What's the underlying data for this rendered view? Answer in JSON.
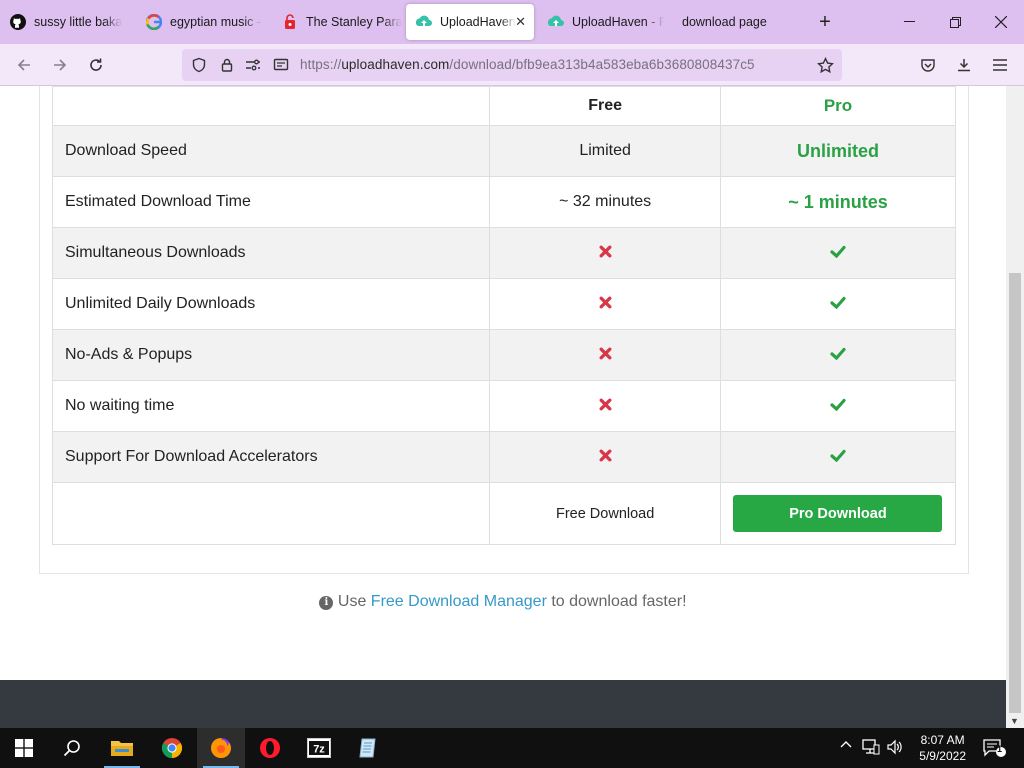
{
  "tabs": [
    {
      "label": "sussy little baka",
      "icon": "github-icon"
    },
    {
      "label": "egyptian music -",
      "icon": "google-icon"
    },
    {
      "label": "The Stanley Parab",
      "icon": "game-icon"
    },
    {
      "label": "UploadHaven",
      "icon": "uploadhaven-icon",
      "active": true
    },
    {
      "label": "UploadHaven - Fi",
      "icon": "uploadhaven-icon"
    },
    {
      "label": "download page",
      "icon": ""
    }
  ],
  "url": {
    "scheme": "https://",
    "host": "uploadhaven.com",
    "path": "/download/bfb9ea313b4a583eba6b3680808437c5"
  },
  "table": {
    "header_free": "Free",
    "header_pro": "Pro",
    "rows": [
      {
        "feature": "Download Speed",
        "free": "Limited",
        "pro": "Unlimited"
      },
      {
        "feature": "Estimated Download Time",
        "free": "~ 32 minutes",
        "pro": "~ 1 minutes"
      },
      {
        "feature": "Simultaneous Downloads"
      },
      {
        "feature": "Unlimited Daily Downloads"
      },
      {
        "feature": "No-Ads & Popups"
      },
      {
        "feature": "No waiting time"
      },
      {
        "feature": "Support For Download Accelerators"
      }
    ],
    "free_download": "Free Download",
    "pro_download": "Pro Download"
  },
  "fdm": {
    "prefix": "Use",
    "link": "Free Download Manager",
    "suffix": "to download faster!"
  },
  "taskbar": {
    "time": "8:07 AM",
    "date": "5/9/2022",
    "notifications": "1"
  },
  "colors": {
    "tab_strip": "#ddbff0",
    "pro_green": "#28a745",
    "cross_red": "#d9364a",
    "link_blue": "#3599c9"
  }
}
